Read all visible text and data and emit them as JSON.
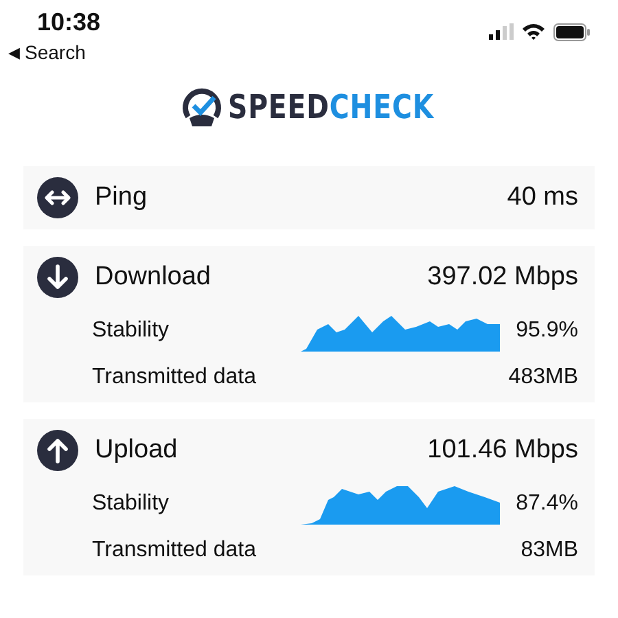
{
  "status_bar": {
    "time": "10:38",
    "back_arrow": "◀",
    "back_label": "Search"
  },
  "logo": {
    "first": "SPEED",
    "second": "CHECK"
  },
  "results": [
    {
      "kind": "ping",
      "label": "Ping",
      "value": "40 ms"
    },
    {
      "kind": "download",
      "label": "Download",
      "value": "397.02 Mbps",
      "stability_label": "Stability",
      "stability": "95.9%",
      "data_label": "Transmitted data",
      "data": "483MB"
    },
    {
      "kind": "upload",
      "label": "Upload",
      "value": "101.46 Mbps",
      "stability_label": "Stability",
      "stability": "87.4%",
      "data_label": "Transmitted data",
      "data": "83MB"
    }
  ]
}
